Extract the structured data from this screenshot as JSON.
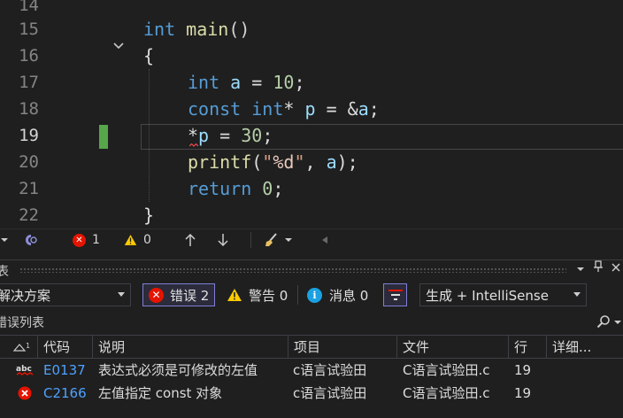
{
  "editor": {
    "lines": [
      {
        "num": "14"
      },
      {
        "num": "15"
      },
      {
        "num": "16"
      },
      {
        "num": "17"
      },
      {
        "num": "18"
      },
      {
        "num": "19"
      },
      {
        "num": "20"
      },
      {
        "num": "21"
      },
      {
        "num": "22"
      }
    ],
    "active_line": "19",
    "colors": {
      "keyword": "#569cd6",
      "function": "#dcdcaa",
      "variable": "#9cdcfe",
      "number": "#b5cea8",
      "string": "#d69d85",
      "change_bar": "#57a64a"
    }
  },
  "editor_status": {
    "error_count": "1",
    "warning_count": "0",
    "icons": [
      "health-icon",
      "error-icon",
      "warning-icon",
      "arrow-up-icon",
      "arrow-down-icon",
      "brush-icon"
    ]
  },
  "panel": {
    "title": "表",
    "scope_combo": "解决方案",
    "errors_btn": "错误 2",
    "warnings_btn": "警告 0",
    "messages_btn": "消息 0",
    "source_combo": "生成 + IntelliSense",
    "search_label": "错误列表",
    "columns": [
      "代码",
      "说明",
      "项目",
      "文件",
      "行",
      "详细..."
    ],
    "rows": [
      {
        "icon": "abc-spelling-error-icon",
        "code": "E0137",
        "desc": "表达式必须是可修改的左值",
        "project": "c语言试验田",
        "file": "C语言试验田.c",
        "line": "19"
      },
      {
        "icon": "error-x-icon",
        "code": "C2166",
        "desc": "左值指定 const 对象",
        "project": "c语言试验田",
        "file": "C语言试验田.c",
        "line": "19"
      }
    ]
  }
}
